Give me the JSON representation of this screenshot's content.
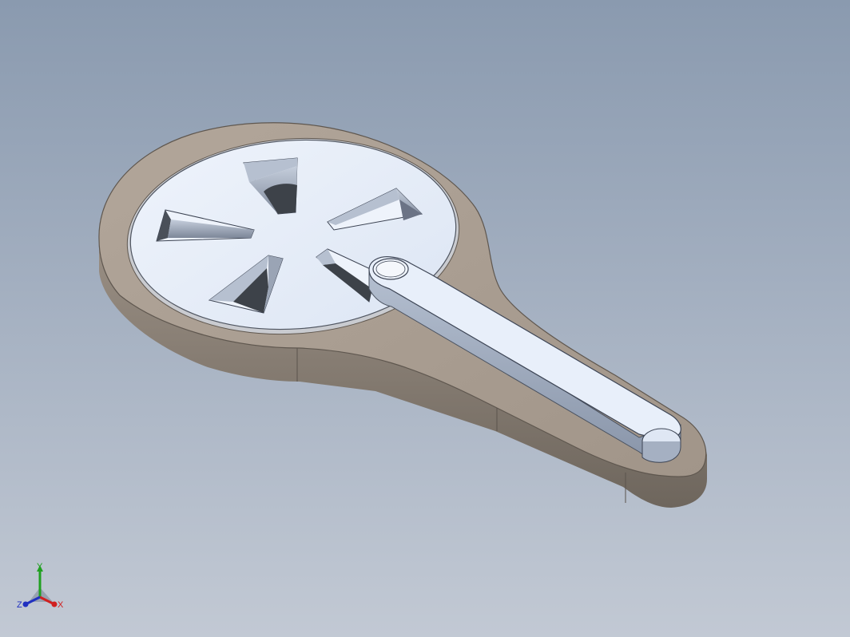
{
  "viewport": {
    "background_top": "#8a9aaf",
    "background_bottom": "#c2c9d4"
  },
  "model": {
    "body_color": "#a89c90",
    "body_side_color": "#8a8075",
    "disc_color": "#e8effa",
    "arm_color": "#e8effa",
    "slot_count": 5
  },
  "triad": {
    "x_label": "X",
    "y_label": "Y",
    "z_label": "Z",
    "x_color": "#d02020",
    "y_color": "#20a020",
    "z_color": "#2030c0"
  }
}
